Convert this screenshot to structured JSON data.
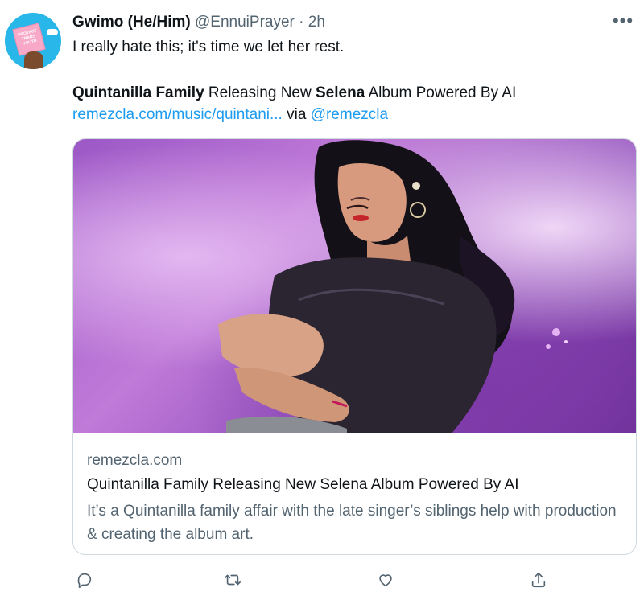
{
  "tweet": {
    "author_name": "Gwimo (He/Him)",
    "handle": "@EnnuiPrayer",
    "separator": " · ",
    "time": "2h",
    "text": "I really hate this; it's time we let her rest.",
    "headline_part1": "Quintanilla Family",
    "headline_part2": " Releasing New ",
    "headline_part3": "Selena",
    "headline_part4": " Album Powered By AI",
    "link_text": "remezcla.com/music/quintani...",
    "via_text": " via ",
    "via_handle": "@remezcla",
    "avatar_sign_text": "PROTECT TRANS YOUTH",
    "more_icon": "more-icon"
  },
  "card": {
    "domain": "remezcla.com",
    "title": "Quintanilla Family Releasing New Selena Album Powered By AI",
    "description": "It’s a Quintanilla family affair with the late singer’s siblings help with production & creating the album art."
  },
  "actions": {
    "icons": [
      "reply-icon",
      "retweet-icon",
      "like-icon",
      "share-icon"
    ]
  },
  "colors": {
    "link": "#1d9bf0",
    "muted": "#536471",
    "text": "#0f1419",
    "border": "#cfd9de"
  }
}
